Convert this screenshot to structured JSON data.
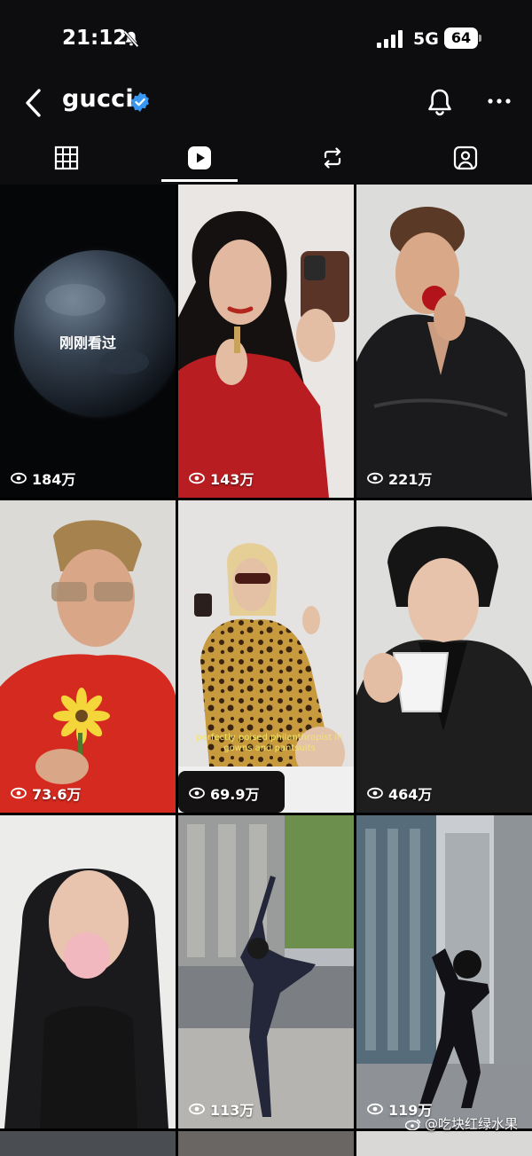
{
  "status_bar": {
    "time": "21:12",
    "network": "5G",
    "battery": "64"
  },
  "header": {
    "username": "gucci",
    "icons": [
      "back-chevron-icon",
      "verified-badge-icon",
      "bell-icon",
      "more-icon"
    ]
  },
  "tabs": [
    {
      "name": "grid",
      "icon": "grid-icon",
      "active": false
    },
    {
      "name": "reels",
      "icon": "reels-play-icon",
      "active": true
    },
    {
      "name": "reposts",
      "icon": "repost-icon",
      "active": false
    },
    {
      "name": "tagged",
      "icon": "tagged-person-icon",
      "active": false
    }
  ],
  "reels": [
    {
      "views": "184万",
      "overlay": "刚刚看过"
    },
    {
      "views": "143万"
    },
    {
      "views": "221万"
    },
    {
      "views": "73.6万"
    },
    {
      "views": "69.9万",
      "caption": "perfectly poised philanthropist in gowns and pantsuits"
    },
    {
      "views": "464万"
    },
    {
      "views": "113万"
    },
    {
      "views": "119万"
    }
  ],
  "watermark": "@吃块红绿水果",
  "colors": {
    "background": "#000000",
    "bar": "#0d0d0f",
    "verified": "#3897f0",
    "caption": "#f2e46a"
  }
}
